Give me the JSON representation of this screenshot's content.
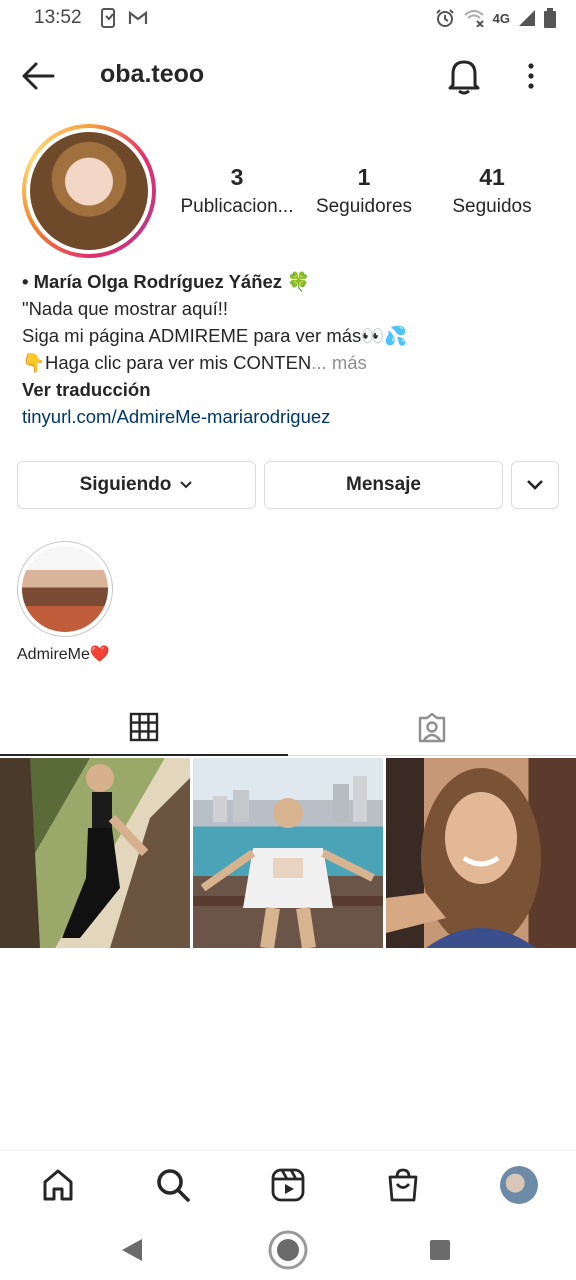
{
  "status_bar": {
    "time": "13:52",
    "network": "4G"
  },
  "header": {
    "username": "oba.teoo"
  },
  "stats": [
    {
      "value": "3",
      "label": "Publicacion..."
    },
    {
      "value": "1",
      "label": "Seguidores"
    },
    {
      "value": "41",
      "label": "Seguidos"
    }
  ],
  "bio": {
    "name": "• María Olga Rodríguez Yáñez 🍀",
    "line1": "\"Nada que mostrar aquí!!",
    "line2": "Siga mi página ADMIREME para ver más👀💦",
    "line3": "👇Haga clic para ver mis CONTEN",
    "more": "... más",
    "translate": "Ver traducción",
    "link": "tinyurl.com/AdmireMe-mariarodriguez"
  },
  "buttons": {
    "following": "Siguiendo",
    "message": "Mensaje"
  },
  "highlight": {
    "label": "AdmireMe❤️"
  },
  "icons": {
    "back": "arrow-left-icon",
    "bell": "bell-icon",
    "more": "more-vertical-icon",
    "grid": "grid-icon",
    "tagged": "tagged-icon",
    "home": "home-icon",
    "search": "search-icon",
    "reels": "reels-icon",
    "shop": "shop-icon"
  },
  "colors": {
    "link": "#00376b",
    "muted": "#8e8e8e",
    "border": "#dbdbdb"
  }
}
